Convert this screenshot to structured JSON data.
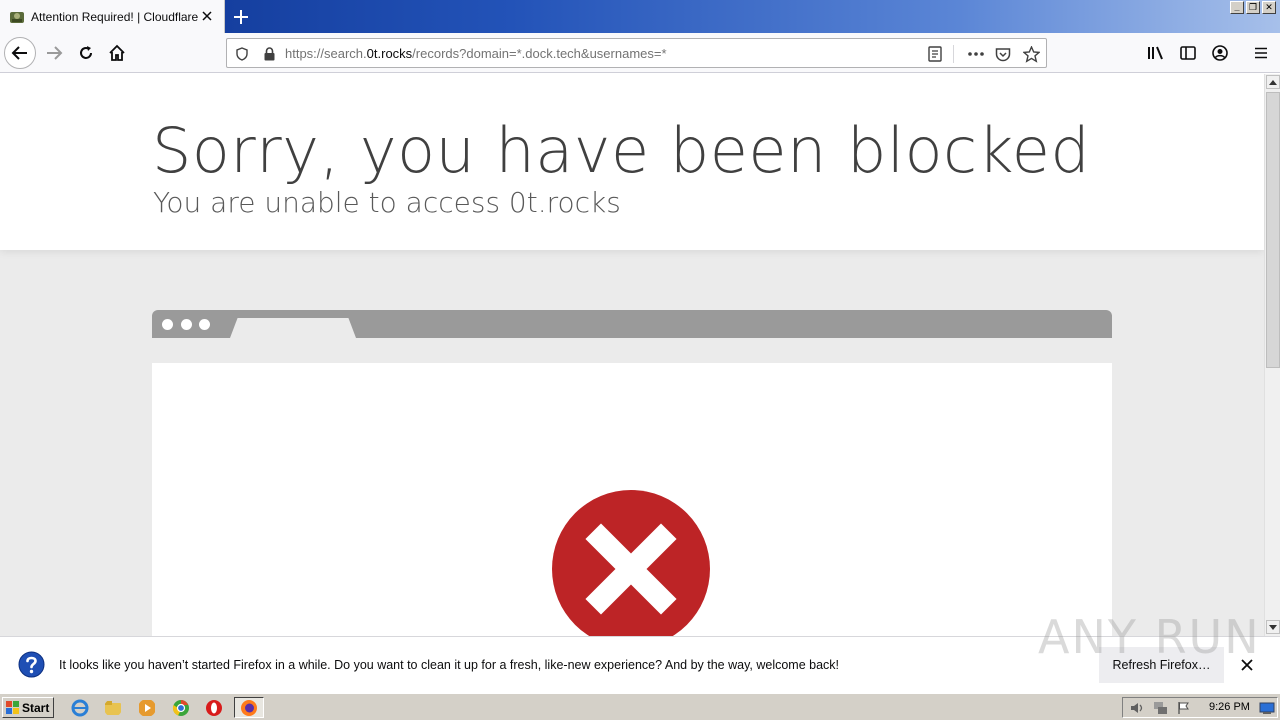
{
  "browser": {
    "tab_title": "Attention Required! | Cloudflare",
    "url_prefix": "https://search.",
    "url_host": "0t.rocks",
    "url_path": "/records?domain=*.dock.tech&usernames=*",
    "window_controls": [
      "_",
      "❐",
      "✕"
    ]
  },
  "page": {
    "heading": "Sorry, you have been blocked",
    "subheading": "You are unable to access 0t.rocks",
    "error_color": "#bd2426"
  },
  "notification": {
    "message": "It looks like you haven’t started Firefox in a while. Do you want to clean it up for a fresh, like-new experience? And by the way, welcome back!",
    "button_label": "Refresh Firefox…"
  },
  "watermark": "ANY RUN",
  "taskbar": {
    "start_label": "Start",
    "clock": "9:26 PM"
  }
}
